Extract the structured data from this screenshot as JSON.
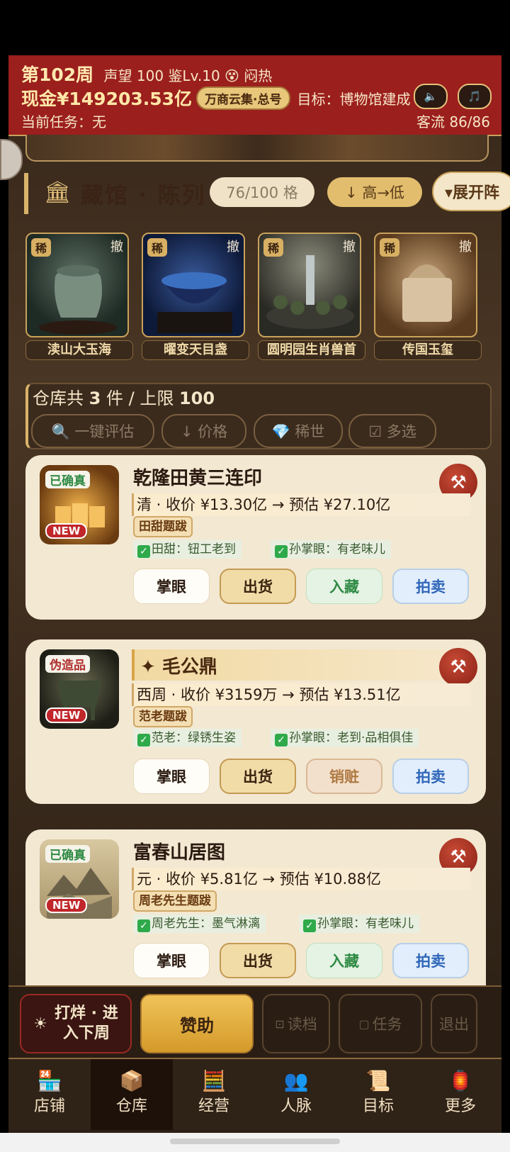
{
  "header": {
    "week": "第102周",
    "reputation": "声望 100",
    "level": "鉴Lv.10",
    "mood_emoji": "😵",
    "mood": "闷热",
    "cash": "现金¥149203.53亿",
    "account": "万商云集·总号",
    "goal": "目标：博物馆建成",
    "sound_icon": "🔈",
    "music_icon": "🎵",
    "task": "当前任务：无",
    "traffic": "客流 86/86"
  },
  "museum": {
    "icon": "🏛",
    "title": "藏馆 · 陈列",
    "slots": "76/100 格",
    "sort": "↓ 高→低",
    "expand": "▾展开阵",
    "items": [
      {
        "tag": "稀",
        "remove": "撤",
        "name": "渎山大玉海"
      },
      {
        "tag": "稀",
        "remove": "撤",
        "name": "曜变天目盏"
      },
      {
        "tag": "稀",
        "remove": "撤",
        "name": "圆明园生肖兽首"
      },
      {
        "tag": "稀",
        "remove": "撤",
        "name": "传国玉玺"
      }
    ]
  },
  "warehouse": {
    "prefix": "仓库共 ",
    "count": "3",
    "mid": " 件 / 上限 ",
    "limit": "100",
    "filters": [
      "🔍 一键评估",
      "↓ 价格",
      "💎 稀世",
      "☑ 多选"
    ]
  },
  "cards": [
    {
      "status": "已确真",
      "new": "NEW",
      "title": "乾隆田黄三连印",
      "price": "清 · 收价 ¥13.30亿 → 预估 ¥27.10亿",
      "seal": "田甜题跋",
      "notes": [
        "田甜：钮工老到",
        "孙掌眼：有老味儿"
      ],
      "actions": [
        "掌眼",
        "出货",
        "入藏",
        "拍卖"
      ]
    },
    {
      "status": "伪造品",
      "new": "NEW",
      "title": "✦ 毛公鼎",
      "price": "西周 · 收价 ¥3159万 → 预估 ¥13.51亿",
      "seal": "范老题跋",
      "notes": [
        "范老：绿锈生姿",
        "孙掌眼：老到·品相俱佳"
      ],
      "actions": [
        "掌眼",
        "出货",
        "销赃",
        "拍卖"
      ]
    },
    {
      "status": "已确真",
      "new": "NEW",
      "title": "富春山居图",
      "price": "元 · 收价 ¥5.81亿 → 预估 ¥10.88亿",
      "seal": "周老先生题跋",
      "notes": [
        "周老先生：墨气淋漓",
        "孙掌眼：有老味儿"
      ],
      "actions": [
        "掌眼",
        "出货",
        "入藏",
        "拍卖"
      ]
    }
  ],
  "action_bar": {
    "next_week": "打烊 · 进\n入下周",
    "sponsor": "赞助",
    "load": "读档",
    "task": "任务",
    "exit": "退出"
  },
  "tabs": [
    {
      "icon": "🏪",
      "label": "店铺"
    },
    {
      "icon": "📦",
      "label": "仓库"
    },
    {
      "icon": "🧮",
      "label": "经营"
    },
    {
      "icon": "👥",
      "label": "人脉"
    },
    {
      "icon": "📜",
      "label": "目标"
    },
    {
      "icon": "🏮",
      "label": "更多"
    }
  ],
  "colors": {
    "header_red": "#9b1f1d",
    "gold": "#d9b36a",
    "card_bg": "#f3e8d2",
    "tab_bg": "#2f2217"
  }
}
